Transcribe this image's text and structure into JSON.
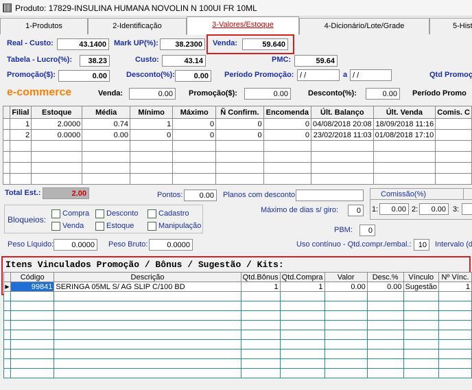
{
  "window": {
    "title": "Produto: 17829-INSULINA HUMANA NOVOLIN N 100UI FR 10ML"
  },
  "tabs": [
    "1-Produtos",
    "2-Identificação",
    "3-Valores/Estoque",
    "4-Dicionário/Lote/Grade",
    "5-Hist"
  ],
  "prices": {
    "real_custo_label": "Real - Custo:",
    "real_custo": "43.1400",
    "markup_label": "Mark UP(%):",
    "markup": "38.2300",
    "venda_label": "Venda:",
    "venda": "59.640",
    "tabela_lucro_label": "Tabela - Lucro(%):",
    "tabela_lucro": "38.23",
    "custo_label": "Custo:",
    "custo": "43.14",
    "pmc_label": "PMC:",
    "pmc": "59.64",
    "promocao_label": "Promoção($):",
    "promocao": "0.00",
    "desconto_label": "Desconto(%):",
    "desconto": "0.00",
    "periodo_label": "Período Promoção:",
    "periodo_de": "/ /",
    "periodo_a_label": "a",
    "periodo_ate": "/ /",
    "qtd_promo_label": "Qtd Promoç"
  },
  "ecommerce": {
    "title": "e-commerce",
    "venda_label": "Venda:",
    "venda": "0.00",
    "promocao_label": "Promoção($):",
    "promocao": "0.00",
    "desconto_label": "Desconto(%):",
    "desconto": "0.00",
    "periodo_label": "Período Promo"
  },
  "stock_table": {
    "headers": [
      "Filial",
      "Estoque",
      "Média",
      "Mínimo",
      "Máximo",
      "Ñ Confirm.",
      "Encomenda",
      "Últ. Balanço",
      "Últ. Venda",
      "Comis. C"
    ],
    "rows": [
      [
        "1",
        "2.0000",
        "0.74",
        "1",
        "0",
        "0",
        "0",
        "04/08/2018 20:08",
        "18/09/2018 11:16",
        ""
      ],
      [
        "2",
        "0.0000",
        "0.00",
        "0",
        "0",
        "0",
        "0",
        "23/02/2018 11:03",
        "01/08/2018 17:10",
        ""
      ]
    ]
  },
  "totals": {
    "total_est_label": "Total Est.:",
    "total_est": "2.00",
    "pontos_label": "Pontos:",
    "pontos": "0.00",
    "planos_label": "Planos com desconto:",
    "planos": "",
    "comissao_label": "Comissão(%)",
    "comissao_1_label": "1:",
    "comissao_1": "0.00",
    "comissao_2_label": "2:",
    "comissao_2": "0.00",
    "comissao_3_label": "3:",
    "comissao_3": "0",
    "max_dias_label": "Máximo de dias s/ giro:",
    "max_dias": "0",
    "pbm_label": "PBM:",
    "pbm": "0",
    "peso_liquido_label": "Peso Líquido:",
    "peso_liquido": "0.0000",
    "peso_bruto_label": "Peso Bruto:",
    "peso_bruto": "0.0000",
    "uso_continuo_label": "Uso contínuo - Qtd.compr./embal.:",
    "uso_continuo": "10",
    "intervalo_label": "Intervalo (d"
  },
  "bloqueios": {
    "label": "Bloqueios:",
    "items": [
      "Compra",
      "Desconto",
      "Cadastro",
      "Venda",
      "Estoque",
      "Manipulação"
    ]
  },
  "linked": {
    "title": "Itens Vinculados Promoção / Bônus / Sugestão / Kits:",
    "headers": [
      "Código",
      "Descrição",
      "Qtd.Bônus",
      "Qtd.Compra",
      "Valor",
      "Desc.%",
      "Vínculo",
      "Nº Vínc."
    ],
    "rows": [
      [
        "99841",
        "SERINGA 05ML S/ AG SLIP C/100 BD",
        "1",
        "1",
        "0.00",
        "0.00",
        "Sugestão",
        "1"
      ]
    ]
  },
  "colors": {
    "highlight_border": "#d62020",
    "label_blue": "#1a2ea6",
    "ecommerce_orange": "#f5820a",
    "total_bg": "#b4b4b4",
    "total_value": "#d00000",
    "grid_teal": "#2e8b8b",
    "code_cell_bg": "#1f6fd6"
  }
}
